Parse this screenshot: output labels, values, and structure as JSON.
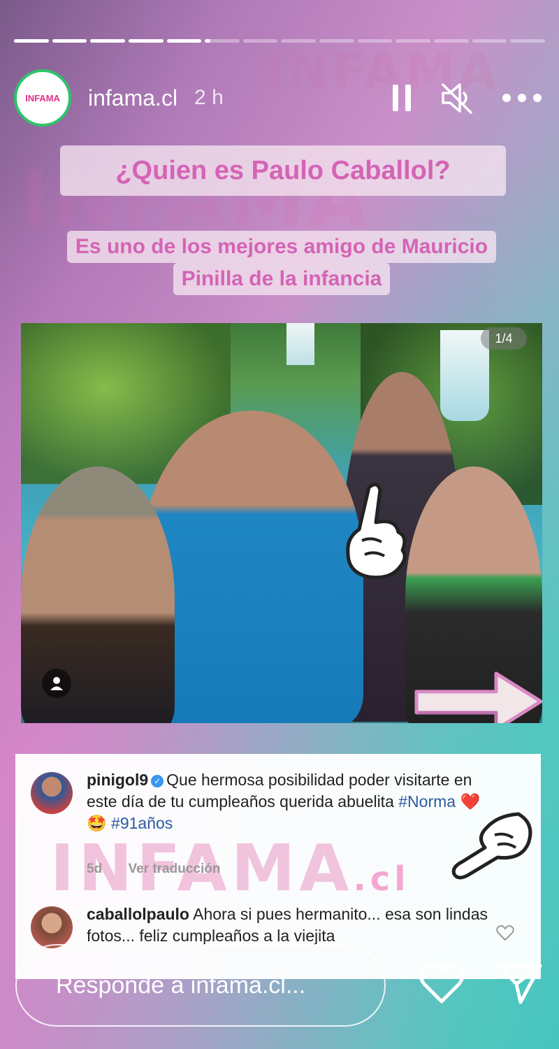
{
  "story": {
    "progress": {
      "total_segments": 14,
      "completed_segments": 5
    },
    "header": {
      "avatar_text": "INFAMA",
      "username": "infama.cl",
      "time_ago": "2 h",
      "icons": [
        "pause-icon",
        "muted-speaker-icon",
        "more-icon"
      ]
    },
    "title": "¿Quien es Paulo Caballol?",
    "subtitle_lines": [
      "Es uno de los  mejores  amigo de Mauricio",
      "Pinilla de la infancia"
    ],
    "watermark_bg": "INFAMA",
    "photo": {
      "counter": "1/4",
      "description_icons": [
        "user-tag-icon",
        "pointing-hand-sticker",
        "arrow-sticker",
        "pointing-hand-down-sticker"
      ]
    },
    "comments": [
      {
        "username": "pinigol9",
        "verified": true,
        "text_before": "Que hermosa posibilidad poder visitarte  en este día de tu cumpleaños querida abuelita",
        "hashtag1": "#Norma",
        "emoji": "❤️ 🤩",
        "hashtag2": "#91años",
        "age": "5d",
        "translate": "Ver traducción"
      },
      {
        "username": "caballolpaulo",
        "text": "Ahora si pues hermanito... esa son lindas fotos... feliz cumpleaños a la viejita"
      }
    ],
    "comment_watermark": "INFAMA",
    "comment_watermark_suffix": ".cl",
    "reply_placeholder": "Responde a infama.cl...",
    "colors": {
      "title_pink": "#d563b5",
      "verified_blue": "#3897f0",
      "hashtag_blue": "#2c5aa0",
      "avatar_ring": "#2fc36a"
    }
  }
}
